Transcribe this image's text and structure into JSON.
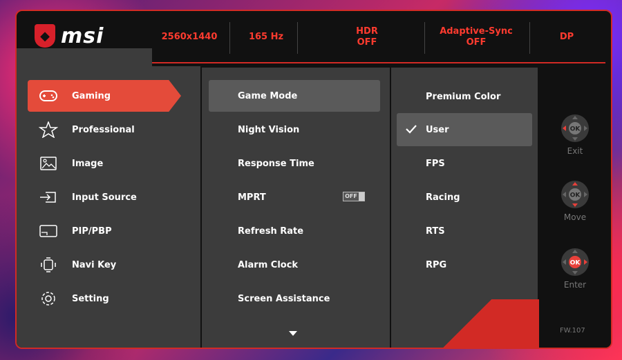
{
  "brand": {
    "name": "msi"
  },
  "status_bar": [
    {
      "line1": "2560x1440",
      "line2": ""
    },
    {
      "line1": "165 Hz",
      "line2": ""
    },
    {
      "line1": "HDR",
      "line2": "OFF"
    },
    {
      "line1": "Adaptive-Sync",
      "line2": "OFF"
    },
    {
      "line1": "DP",
      "line2": ""
    }
  ],
  "main_menu": [
    {
      "label": "Gaming",
      "icon": "gamepad-icon",
      "active": true
    },
    {
      "label": "Professional",
      "icon": "star-icon",
      "active": false
    },
    {
      "label": "Image",
      "icon": "image-icon",
      "active": false
    },
    {
      "label": "Input Source",
      "icon": "input-source-icon",
      "active": false
    },
    {
      "label": "PIP/PBP",
      "icon": "pip-icon",
      "active": false
    },
    {
      "label": "Navi Key",
      "icon": "navi-key-icon",
      "active": false
    },
    {
      "label": "Setting",
      "icon": "gear-icon",
      "active": false
    }
  ],
  "sub_menu": [
    {
      "label": "Game Mode",
      "active": true
    },
    {
      "label": "Night Vision"
    },
    {
      "label": "Response Time"
    },
    {
      "label": "MPRT",
      "toggle": "OFF"
    },
    {
      "label": "Refresh Rate"
    },
    {
      "label": "Alarm Clock"
    },
    {
      "label": "Screen Assistance"
    }
  ],
  "options": [
    {
      "label": "Premium Color"
    },
    {
      "label": "User",
      "selected": true
    },
    {
      "label": "FPS"
    },
    {
      "label": "Racing"
    },
    {
      "label": "RTS"
    },
    {
      "label": "RPG"
    }
  ],
  "nav": [
    {
      "label": "Exit",
      "center": "OK"
    },
    {
      "label": "Move",
      "center": "OK"
    },
    {
      "label": "Enter",
      "center": "OK"
    }
  ],
  "firmware": "FW.107",
  "colors": {
    "accent": "#d22a25",
    "highlight": "#e44b3a",
    "panel": "#3c3c3c",
    "selected": "#5a5a5a"
  }
}
